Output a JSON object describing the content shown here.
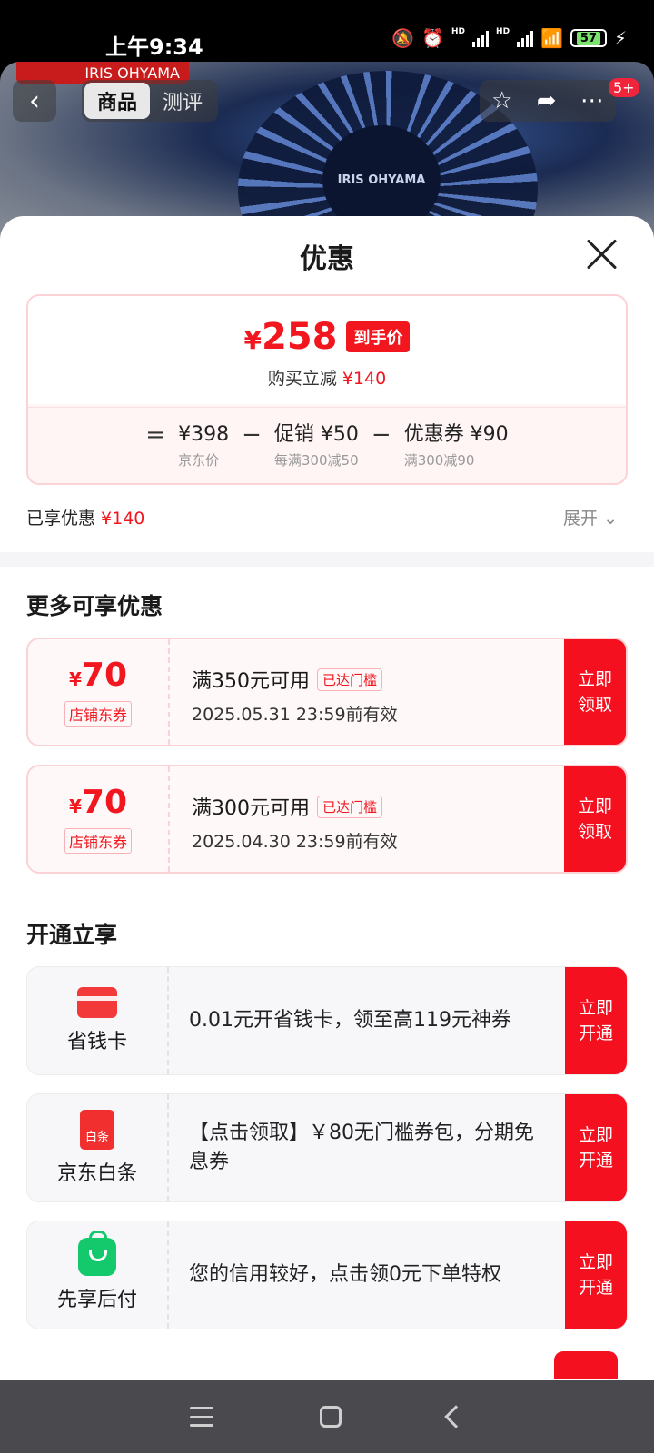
{
  "status_bar": {
    "time": "上午9:34",
    "hd1": "HD",
    "hd2": "HD",
    "battery": "57"
  },
  "product_header": {
    "brand": "IRIS OHYAMA",
    "fan_logo": "IRIS OHYAMA",
    "tabs": [
      {
        "label": "商品",
        "active": true
      },
      {
        "label": "测评",
        "active": false
      }
    ],
    "badge": "5+"
  },
  "sheet": {
    "title": "优惠"
  },
  "price_summary": {
    "final_price_symbol": "¥",
    "final_price": "258",
    "tag": "到手价",
    "reduce_label": "购买立减",
    "reduce_value": "¥140",
    "equals": "=",
    "terms": [
      {
        "value": "¥398",
        "sub": "京东价"
      },
      {
        "op": "−",
        "value": "促销 ¥50",
        "sub": "每满300减50"
      },
      {
        "op": "−",
        "value": "优惠券 ¥90",
        "sub": "满300减90"
      }
    ]
  },
  "enjoyed": {
    "label": "已享优惠",
    "value": "¥140",
    "expand_label": "展开"
  },
  "more_section": {
    "title": "更多可享优惠",
    "coupons": [
      {
        "symbol": "¥",
        "amount": "70",
        "tag": "店铺东券",
        "condition": "满350元可用",
        "reached": "已达门槛",
        "valid": "2025.05.31 23:59前有效",
        "cta": "立即\n领取"
      },
      {
        "symbol": "¥",
        "amount": "70",
        "tag": "店铺东券",
        "condition": "满300元可用",
        "reached": "已达门槛",
        "valid": "2025.04.30 23:59前有效",
        "cta": "立即\n领取"
      }
    ]
  },
  "open_section": {
    "title": "开通立享",
    "items": [
      {
        "name": "省钱卡",
        "icon": "card-icon",
        "desc": "0.01元开省钱卡，领至高119元神券",
        "cta": "立即\n开通"
      },
      {
        "name": "京东白条",
        "icon": "baitiao-icon",
        "icon_text": "白条",
        "desc": "【点击领取】￥80无门槛券包，分期免息券",
        "cta": "立即\n开通"
      },
      {
        "name": "先享后付",
        "icon": "shopping-bag-icon",
        "desc": "您的信用较好，点击领0元下单特权",
        "cta": "立即\n开通"
      }
    ]
  },
  "colors": {
    "accent": "#f2161f",
    "cta": "#f5101f",
    "green": "#14c96b"
  }
}
